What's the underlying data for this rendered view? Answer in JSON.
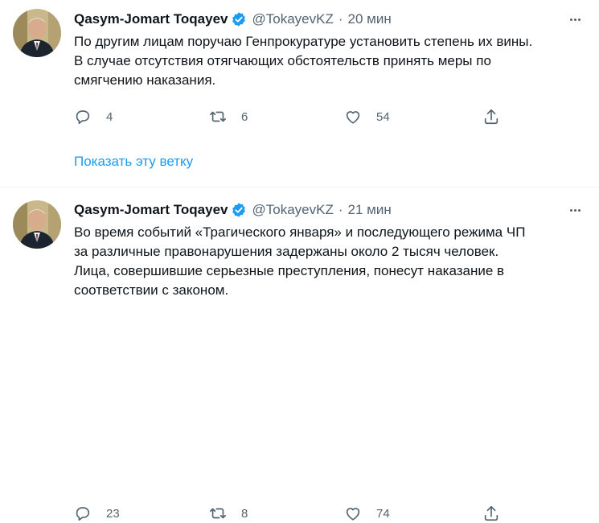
{
  "colors": {
    "accent": "#1d9bf0",
    "text_primary": "#0f1419",
    "text_secondary": "#536471",
    "divider": "#eff3f4"
  },
  "tweets": [
    {
      "author_name": "Qasym-Jomart Toqayev",
      "handle": "@TokayevKZ",
      "separator": "·",
      "time": "20 мин",
      "verified_icon": "verified-badge-icon",
      "text_lines": [
        "По другим лицам поручаю Генпрокуратуре установить степень их вины.",
        "В случае отсутствия отягчающих обстоятельств принять меры по",
        "смягчению наказания."
      ],
      "replies": "4",
      "retweets": "6",
      "likes": "54"
    },
    {
      "author_name": "Qasym-Jomart Toqayev",
      "handle": "@TokayevKZ",
      "separator": "·",
      "time": "21 мин",
      "verified_icon": "verified-badge-icon",
      "text_lines": [
        "Во время событий «Трагического января» и последующего режима ЧП",
        "за различные правонарушения задержаны около 2 тысяч человек.",
        "Лица, совершившие серьезные преступления, понесут наказание в",
        "соответствии с законом."
      ],
      "replies": "23",
      "retweets": "8",
      "likes": "74"
    }
  ],
  "show_thread_label": "Показать эту ветку"
}
